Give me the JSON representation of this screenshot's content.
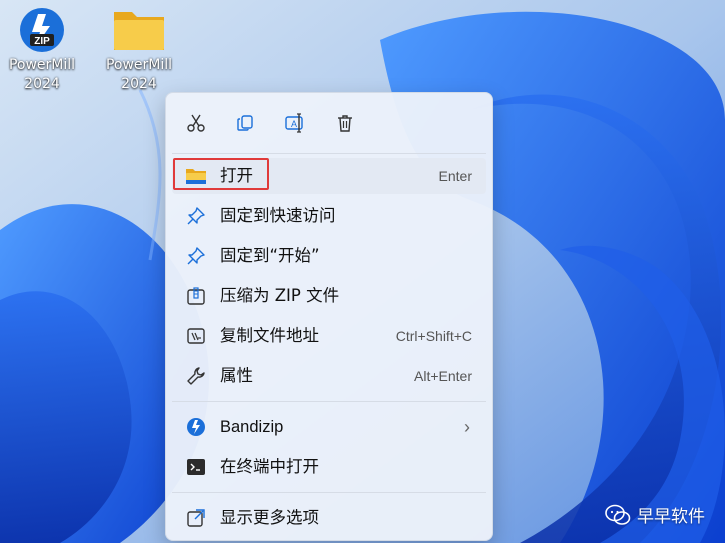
{
  "desktop": {
    "icons": [
      {
        "label_line1": "PowerMill",
        "label_line2": "2024",
        "badge": "ZIP"
      },
      {
        "label_line1": "PowerMill",
        "label_line2": "2024"
      }
    ]
  },
  "toolbar": {
    "cut": "scissors-icon",
    "copy": "copy-icon",
    "rename": "rename-icon",
    "delete": "trash-icon"
  },
  "menu": {
    "open": {
      "label": "打开",
      "shortcut": "Enter"
    },
    "pin_quick": {
      "label": "固定到快速访问"
    },
    "pin_start": {
      "label": "固定到“开始”"
    },
    "compress": {
      "label": "压缩为 ZIP 文件"
    },
    "copy_path": {
      "label": "复制文件地址",
      "shortcut": "Ctrl+Shift+C"
    },
    "properties": {
      "label": "属性",
      "shortcut": "Alt+Enter"
    },
    "bandizip": {
      "label": "Bandizip",
      "shortcut": "›"
    },
    "terminal": {
      "label": "在终端中打开"
    },
    "more": {
      "label": "显示更多选项"
    }
  },
  "watermark": {
    "text": "早早软件"
  },
  "colors": {
    "accent": "#1b6fd9",
    "highlight_border": "#e03a3a",
    "folder": "#f5c232"
  }
}
